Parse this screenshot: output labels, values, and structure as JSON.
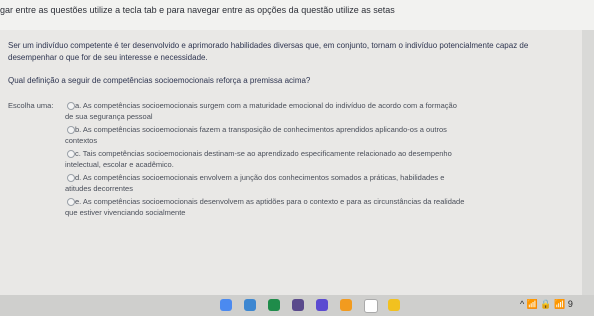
{
  "instruction": "gar entre as questões utilize a tecla tab e para navegar entre as opções da questão utilize as setas",
  "question": {
    "text": "Ser um indivíduo competente é ter desenvolvido e aprimorado habilidades diversas que, em conjunto, tornam o indivíduo potencialmente capaz de desempenhar o que for de seu interesse e necessidade.",
    "prompt": "Qual definição a seguir de competências socioemocionais reforça a premissa acima?",
    "choose_label": "Escolha uma:"
  },
  "options": [
    {
      "line1": "a. As competências socioemocionais surgem com a maturidade emocional do indivíduo de acordo com a formação",
      "line2": "de sua segurança pessoal"
    },
    {
      "line1": "b. As competências socioemocionais fazem a transposição de conhecimentos aprendidos aplicando-os a outros",
      "line2": "contextos"
    },
    {
      "line1": "c. Tais competências socioemocionais destinam-se ao aprendizado especificamente relacionado ao desempenho",
      "line2": "intelectual, escolar e acadêmico."
    },
    {
      "line1": "d. As competências socioemocionais envolvem a junção dos conhecimentos somados a práticas, habilidades e",
      "line2": "atitudes decorrentes"
    },
    {
      "line1": "e. As competências socioemocionais desenvolvem as aptidões para o contexto e para as circunstâncias da realidade",
      "line2": "que estiver vivenciando socialmente"
    }
  ],
  "taskbar": {
    "icons": [
      "browser-icon",
      "files-icon",
      "calendar-icon",
      "gradebook-icon",
      "m-icon",
      "media-icon",
      "google-icon",
      "drive-icon"
    ],
    "tray_text": "^   📶   🔒   📶   9"
  }
}
